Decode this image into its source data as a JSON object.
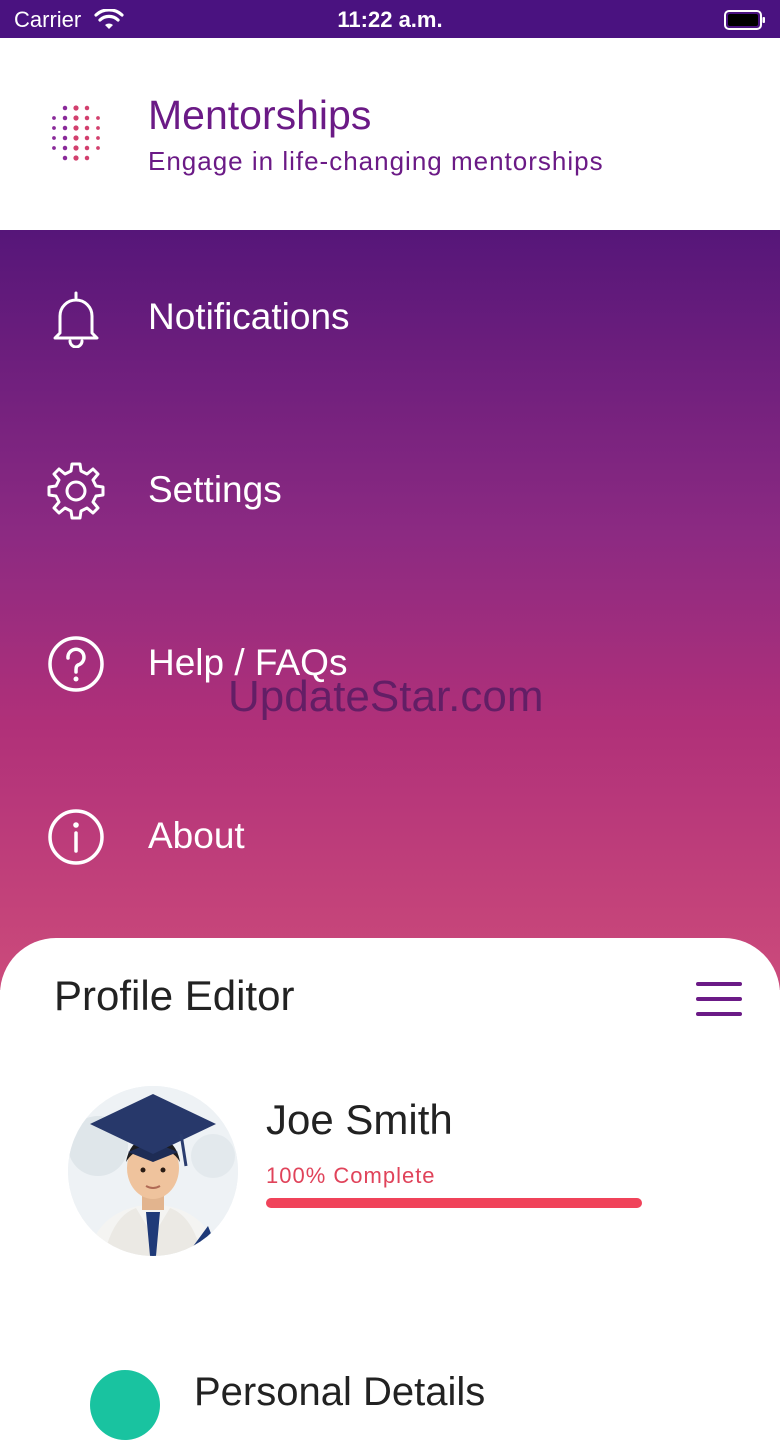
{
  "status_bar": {
    "carrier": "Carrier",
    "time": "11:22 a.m.",
    "wifi_icon": "wifi-icon",
    "battery_icon": "battery-icon"
  },
  "brand": {
    "title": "Mentorships",
    "subtitle": "Engage in life-changing mentorships",
    "logo_icon": "dots-logo-icon"
  },
  "menu": {
    "items": [
      {
        "label": "Notifications",
        "icon": "bell-icon"
      },
      {
        "label": "Settings",
        "icon": "gear-icon"
      },
      {
        "label": "Help / FAQs",
        "icon": "question-circle-icon"
      },
      {
        "label": "About",
        "icon": "info-circle-icon"
      }
    ]
  },
  "watermark": "UpdateStar.com",
  "profile_editor": {
    "title": "Profile Editor",
    "menu_icon": "hamburger-icon",
    "user": {
      "name": "Joe Smith",
      "completion_text": "100% Complete",
      "completion_fraction": 1.0
    },
    "sections": [
      {
        "label": "Personal Details",
        "icon": "personal-details-icon"
      }
    ]
  },
  "colors": {
    "brand_purple": "#6b1a86",
    "statusbar": "#4a1280",
    "progress": "#f0435a",
    "section_icon": "#19c3a0"
  }
}
